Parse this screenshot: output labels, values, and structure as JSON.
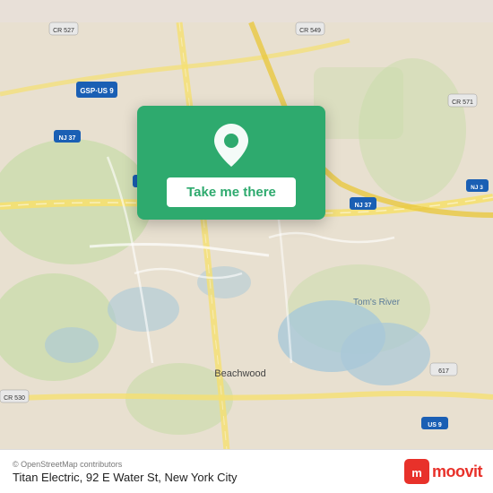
{
  "map": {
    "alt": "Map of Beachwood, New Jersey area",
    "background_color": "#e8e0d8"
  },
  "location_card": {
    "button_label": "Take me there",
    "pin_color": "#ffffff"
  },
  "bottom_bar": {
    "osm_credit": "© OpenStreetMap contributors",
    "location_name": "Titan Electric, 92 E Water St, New York City",
    "moovit_logo_text": "moovit"
  }
}
